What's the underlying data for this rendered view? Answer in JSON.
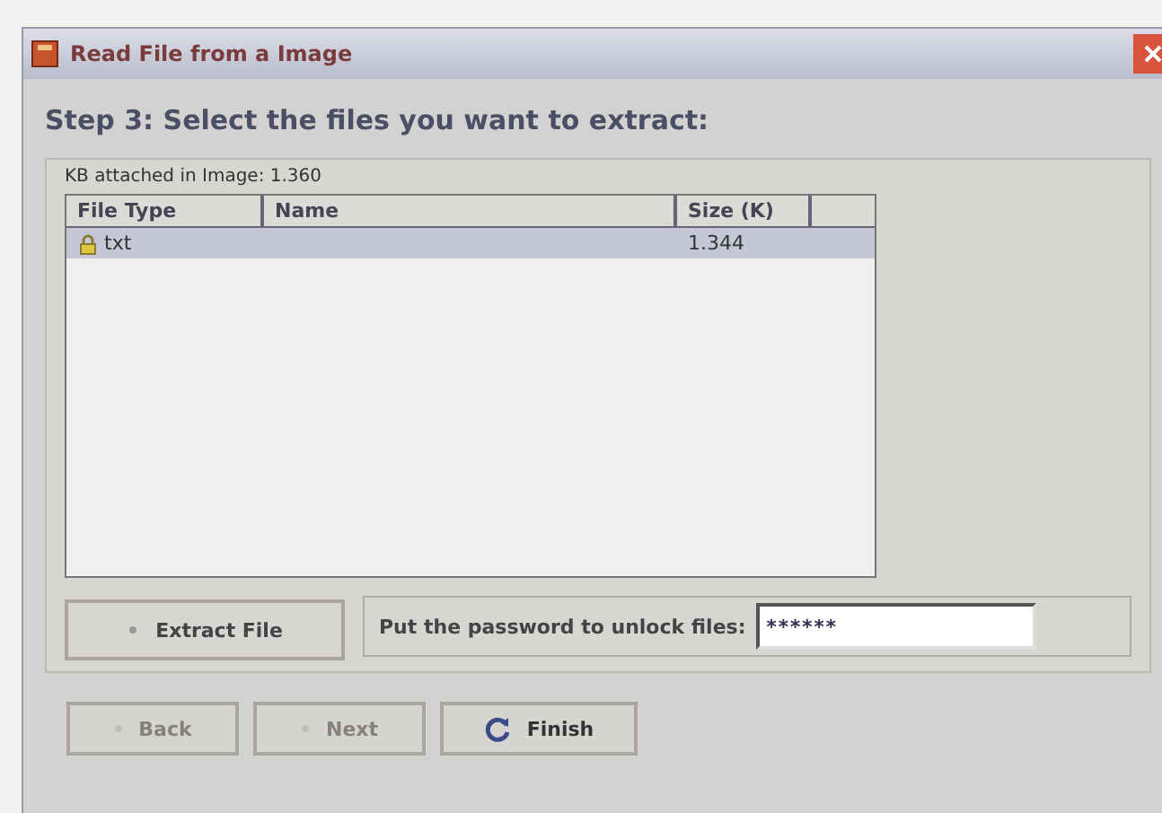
{
  "window": {
    "title": "Read File from a Image"
  },
  "heading": "Step 3: Select the files you want to extract:",
  "group": {
    "label": "KB attached in Image: 1.360"
  },
  "table": {
    "columns": [
      "File Type",
      "Name",
      "Size (K)"
    ],
    "rows": [
      {
        "cells": [
          "txt",
          "",
          "1.344"
        ],
        "locked": true,
        "selected": true
      }
    ]
  },
  "extract_button": {
    "label": "Extract File"
  },
  "password": {
    "label": "Put the password to unlock files:",
    "value": "******"
  },
  "buttons": [
    {
      "label": "Back",
      "disabled": true,
      "kind": "back"
    },
    {
      "label": "Next",
      "disabled": true,
      "kind": "next"
    },
    {
      "label": "Finish",
      "disabled": false,
      "kind": "finish"
    }
  ]
}
